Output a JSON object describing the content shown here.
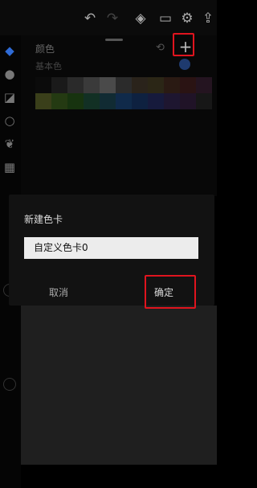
{
  "topbar": {
    "icons": [
      "undo-icon",
      "redo-icon",
      "layers-icon",
      "folder-icon",
      "gear-icon",
      "export-icon"
    ]
  },
  "leftbar": {
    "icons": [
      "brush-icon",
      "smudge-icon",
      "eraser-icon",
      "color-circle-icon",
      "leaf-icon",
      "grid-icon"
    ]
  },
  "panel": {
    "title": "颜色",
    "subtitle": "基本色",
    "add_label": "+",
    "refresh_label": "⟲"
  },
  "swatches": {
    "row1": [
      "#0b0b0b",
      "#1a1a1a",
      "#2a2a2a",
      "#3a3a3a",
      "#4a4a4a",
      "#2b2b2b",
      "#2a231b",
      "#2b2616",
      "#2a1a13",
      "#2a1313",
      "#241420"
    ],
    "row2": [
      "#3a3f1a",
      "#243a12",
      "#17330f",
      "#123024",
      "#112b33",
      "#102a4a",
      "#0e2140",
      "#161a3c",
      "#1e1630",
      "#201327",
      "#171717"
    ]
  },
  "dialog": {
    "title": "新建色卡",
    "input_value": "自定义色卡0",
    "cancel_label": "取消",
    "confirm_label": "确定"
  },
  "colors": {
    "highlight": "#e0141e",
    "accent_blue": "#1e3a6e"
  }
}
